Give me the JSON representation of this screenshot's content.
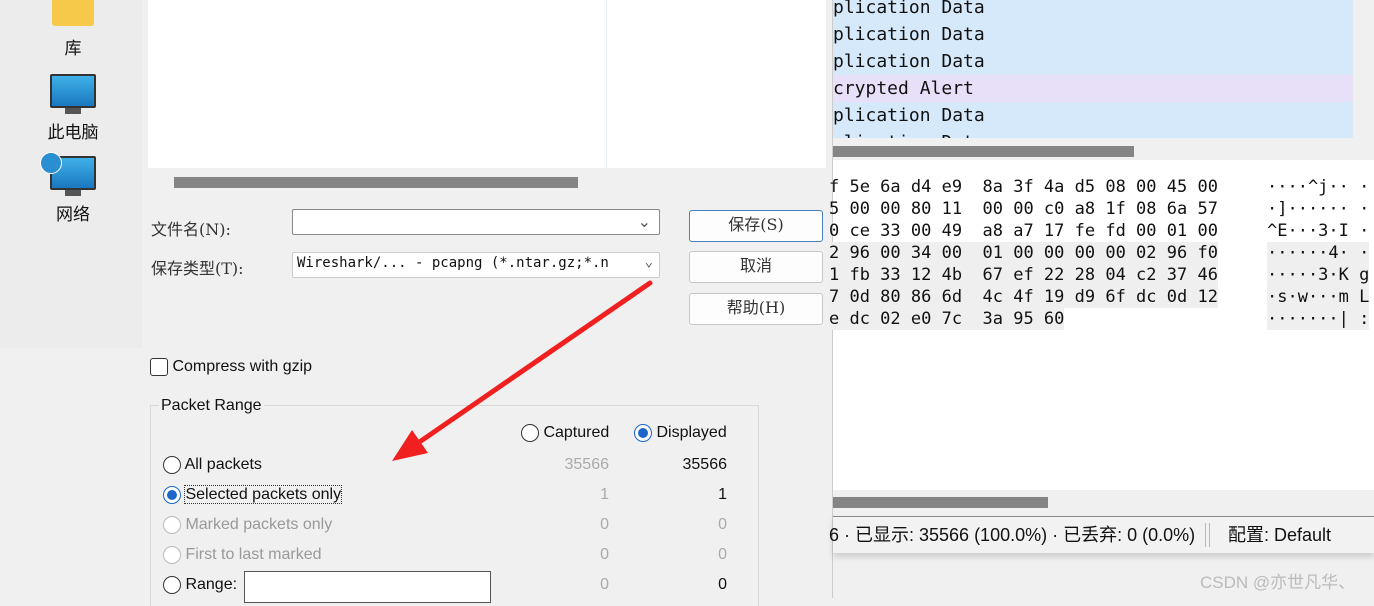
{
  "desktop": {
    "items": [
      {
        "label": "库",
        "icon": "folder-icon"
      },
      {
        "label": "此电脑",
        "icon": "computer-icon"
      },
      {
        "label": "网络",
        "icon": "network-icon"
      }
    ]
  },
  "dialog": {
    "filename_label": "文件名(N):",
    "filename_value": "",
    "filetype_label": "保存类型(T):",
    "filetype_value": "Wireshark/... - pcapng (*.ntar.gz;*.n",
    "save": "保存(S)",
    "cancel": "取消",
    "help": "帮助(H)",
    "compress": "Compress with gzip",
    "range": {
      "title": "Packet Range",
      "captured": "Captured",
      "displayed": "Displayed",
      "rows": [
        {
          "label": "All packets",
          "captured": "35566",
          "displayed": "35566"
        },
        {
          "label": "Selected packets only",
          "captured": "1",
          "displayed": "1"
        },
        {
          "label": "Marked packets only",
          "captured": "0",
          "displayed": "0"
        },
        {
          "label": "First to last marked",
          "captured": "0",
          "displayed": "0"
        },
        {
          "label": "Range:",
          "captured": "0",
          "displayed": "0"
        }
      ]
    }
  },
  "packets": [
    "plication Data",
    "plication Data",
    "plication Data",
    "crypted Alert",
    "plication Data",
    "plication Data"
  ],
  "hex": [
    {
      "h": "f 5e 6a d4 e9  8a 3f 4a d5 08 00 45 00",
      "a": "····^j·· ·"
    },
    {
      "h": "5 00 00 80 11  00 00 c0 a8 1f 08 6a 57",
      "a": "·]······ ·"
    },
    {
      "h": "0 ce 33 00 49  a8 a7 17 fe fd 00 01 00",
      "a": "^E···3·I ·"
    },
    {
      "h": "2 96 00 34 00  01 00 00 00 00 02 96 f0",
      "a": "······4· ·"
    },
    {
      "h": "1 fb 33 12 4b  67 ef 22 28 04 c2 37 46",
      "a": "·····3·K g"
    },
    {
      "h": "7 0d 80 86 6d  4c 4f 19 d9 6f dc 0d 12",
      "a": "·s·w···m L"
    },
    {
      "h": "e dc 02 e0 7c  3a 95 60",
      "a": "·······| :"
    }
  ],
  "status": {
    "text": "6 · 已显示: 35566 (100.0%) · 已丢弃: 0 (0.0%)",
    "profile": "配置:  Default"
  },
  "watermark": "CSDN @亦世凡华、",
  "colors": {
    "selected_row": "#d6e9fb",
    "alert_row": "#e8e0f8",
    "annotation_arrow": "#f02020",
    "radio_accent": "#1e66c8"
  }
}
